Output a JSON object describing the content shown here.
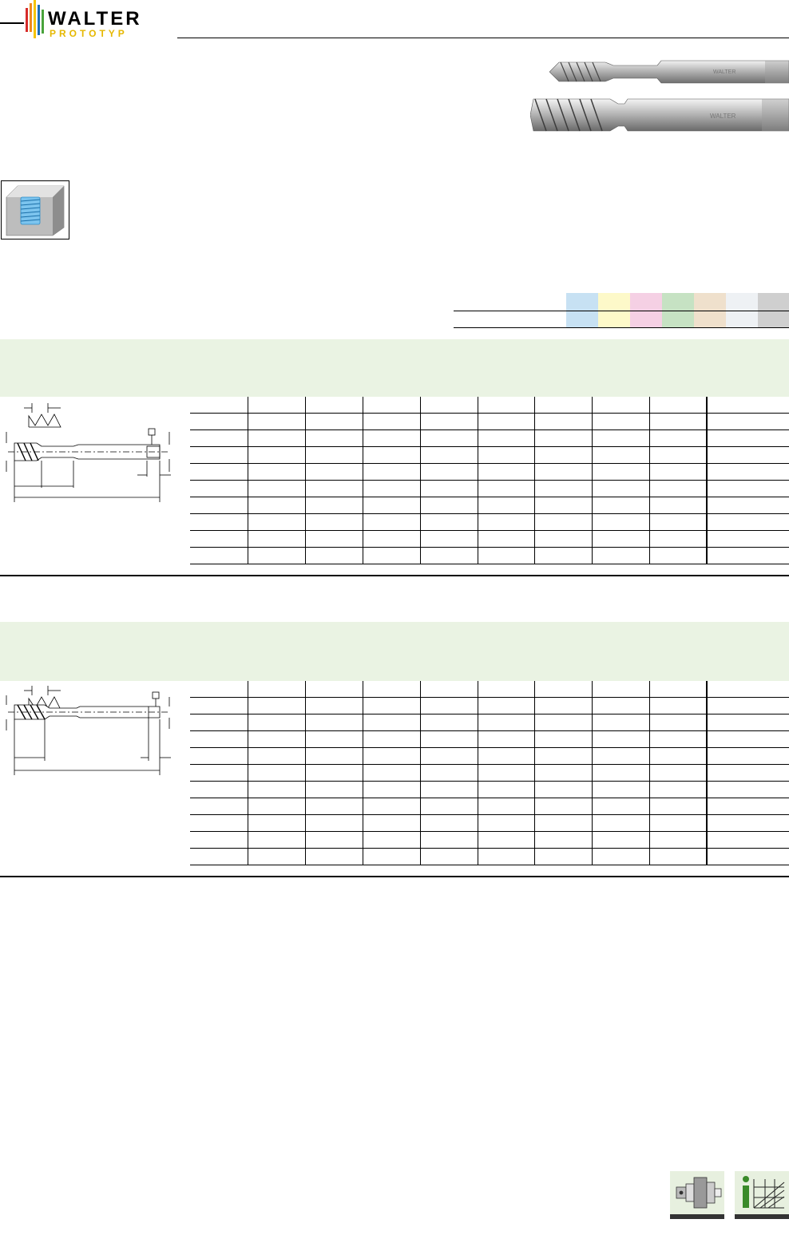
{
  "header": {
    "logo_brand": "WALTER",
    "logo_sub": "PROTOTYP",
    "colors": {
      "bar_red": "#d62a2a",
      "bar_orange": "#ef8a1f",
      "bar_yellow": "#f5c400",
      "bar_blue": "#1d6fb8",
      "bar_green": "#49a33b",
      "bar_purple": "#8f4aa0",
      "sub_text": "#e6b800"
    }
  },
  "product_images": [
    {
      "name": "spiral-flute-tap-short",
      "brand_mark": "WALTER"
    },
    {
      "name": "spiral-flute-tap-long",
      "brand_mark": "WALTER"
    }
  ],
  "material_groups": {
    "swatch_colors": [
      "#c7e1f3",
      "#fdf9c9",
      "#f5d0e4",
      "#c6e2c3",
      "#efe0cc",
      "#eef1f4",
      "#cfcfcf"
    ]
  },
  "sections": [
    {
      "id": "section-1",
      "band_color": "#eaf3e3",
      "rows": 10,
      "cols": 10
    },
    {
      "id": "section-2",
      "band_color": "#eaf3e3",
      "rows": 11,
      "cols": 10
    }
  ],
  "footer_icons": [
    {
      "name": "tool-holder-icon"
    },
    {
      "name": "info-chart-icon"
    }
  ]
}
